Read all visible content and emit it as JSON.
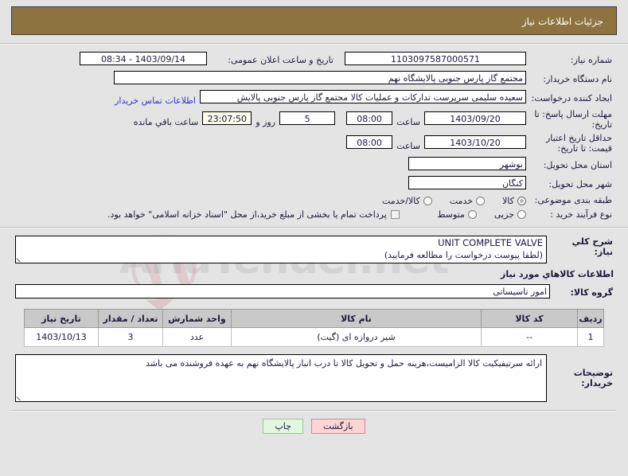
{
  "header": {
    "title": "جزئیات اطلاعات نیاز"
  },
  "watermark": {
    "text": "AriaTender.net"
  },
  "form": {
    "need_number": {
      "label": "شماره نیاز:",
      "value": "1103097587000571"
    },
    "public_announce": {
      "label": "تاریخ و ساعت اعلان عمومی:",
      "value": "1403/09/14 - 08:34"
    },
    "buyer_org": {
      "label": "نام دستگاه خریدار:",
      "value": "مجتمع گاز پارس جنوبی  پالایشگاه نهم"
    },
    "creator": {
      "label": "ایجاد کننده درخواست:",
      "value": "سعیده سلیمی سرپرست تدارکات و عملیات کالا مجتمع گاز پارس جنوبی  پالایش",
      "contact_link": "اطلاعات تماس خریدار"
    },
    "reply_deadline": {
      "label": "مهلت ارسال پاسخ: تا تاریخ:",
      "date": "1403/09/20",
      "time_label": "ساعت",
      "time": "08:00",
      "days": "5",
      "days_label": "روز و",
      "countdown": "23:07:50",
      "countdown_label": "ساعت باقي مانده"
    },
    "price_validity": {
      "label": "حداقل تاریخ اعتبار قیمت: تا تاریخ:",
      "date": "1403/10/20",
      "time_label": "ساعت",
      "time": "08:00"
    },
    "province": {
      "label": "استان محل تحویل:",
      "value": "بوشهر"
    },
    "city": {
      "label": "شهر محل تحویل:",
      "value": "کنگان"
    },
    "category": {
      "label": "طبقه بندی موضوعی:",
      "options": [
        "کالا",
        "خدمت",
        "کالا/خدمت"
      ],
      "selected": "کالا"
    },
    "process_type": {
      "label": "نوع فرآیند خرید :",
      "options": [
        "جزیی",
        "متوسط"
      ],
      "selected": "",
      "treasury_note": "پرداخت تمام یا بخشی از مبلغ خرید،از محل \"اسناد خزانه اسلامی\" خواهد بود.",
      "treasury_checked": false
    }
  },
  "description": {
    "label": "شرح کلي نیاز:",
    "line_en": "UNIT COMPLETE VALVE",
    "line_fa": "(لطفا پیوست درخواست را مطالعه فرمایید)"
  },
  "goods_section": {
    "title": "اطلاعات کالاهاي مورد نیاز",
    "group_label": "گروه کالا:",
    "group_value": "امور تاسیساتی"
  },
  "items_table": {
    "columns": [
      "ردیف",
      "کد کالا",
      "نام کالا",
      "واحد شمارش",
      "تعداد / مقدار",
      "تاریخ نیاز"
    ],
    "rows": [
      {
        "radif": "1",
        "code": "--",
        "name": "شیر دروازه ای (گیت)",
        "unit": "عدد",
        "qty": "3",
        "need_date": "1403/10/13"
      }
    ]
  },
  "buyer_notes": {
    "label": "توضیحات خریدار:",
    "value": "ارائه سرتیفیکیت کالا الزامیست،هزینه حمل و تحویل کالا تا درب انبار پالایشگاه نهم به عهده فروشنده می باشد"
  },
  "footer": {
    "back_label": "بازگشت",
    "print_label": "چاپ"
  },
  "colors": {
    "header_bg": "#8d7340",
    "page_bg": "#e4e4e4",
    "link": "#3333cc",
    "table_header_bg": "#c9c9c9",
    "back_btn_bg": "#ffd4d4",
    "print_btn_bg": "#e3f7e0",
    "countdown_bg": "#fbfbe8"
  }
}
